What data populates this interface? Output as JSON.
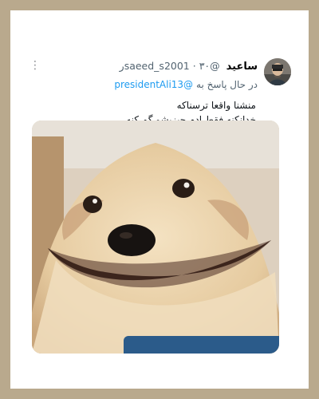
{
  "tweet": {
    "display_name": "ساعید",
    "handle": "@saeed_s2001",
    "time": "۳۰ر",
    "reply_prefix": "در حال پاسخ به",
    "reply_to": "@presidentAli13",
    "text_lines": [
      "منشنا واقعا ترسناکه",
      "خدانکنه فقط ادم چیزیشو گم کنه"
    ],
    "media_alt_icon": "dog-photo",
    "more_icon": "kebab-menu-icon"
  },
  "colors": {
    "frame_border": "#b9a98d",
    "link": "#1d9bf0",
    "secondary_text": "#536471"
  }
}
